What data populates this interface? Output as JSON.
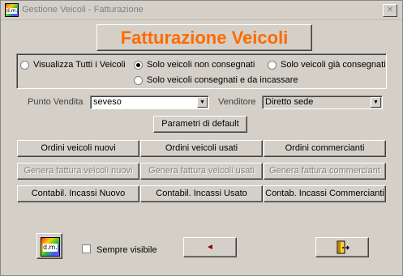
{
  "window": {
    "title": "Gestione Veicoli - Fatturazione",
    "close_label": "✕"
  },
  "app_icon": {
    "text": "d.m."
  },
  "header": {
    "title": "Fatturazione Veicoli"
  },
  "filters": {
    "options": [
      {
        "label": "Visualizza Tutti i Veicoli",
        "checked": false
      },
      {
        "label": "Solo veicoli non consegnati",
        "checked": true
      },
      {
        "label": "Solo veicoli già consegnati",
        "checked": false
      },
      {
        "label": "Solo veicoli consegnati e da incassare",
        "checked": false
      }
    ]
  },
  "punto_vendita": {
    "label": "Punto Vendita",
    "value": "seveso"
  },
  "venditore": {
    "label": "Venditore",
    "value": "Diretto sede"
  },
  "default_button": "Parametri di default",
  "actions": {
    "row1": [
      "Ordini veicoli nuovi",
      "Ordini veicoli usati",
      "Ordini commercianti"
    ],
    "row2": [
      "Genera fattura veicoli nuovi",
      "Genera fattura veicoli usati",
      "Genera fattura commerciant"
    ],
    "row3": [
      "Contabil. Incassi Nuovo",
      "Contabil. Incassi Usato",
      "Contab. Incassi Commercianti"
    ]
  },
  "footer": {
    "logo_text": "d.m.",
    "sempre_visibile": {
      "label": "Sempre visibile",
      "checked": false
    },
    "back_icon": "◄"
  },
  "colors": {
    "title_orange": "#ff6a00",
    "face": "#d4d0c8"
  }
}
